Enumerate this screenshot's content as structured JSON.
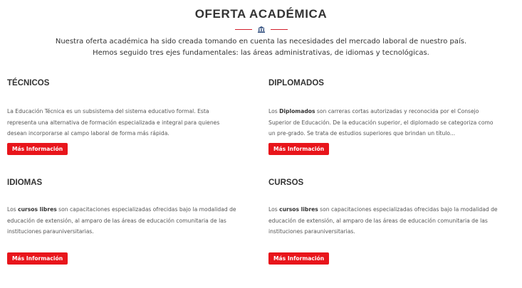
{
  "header": {
    "title": "OFERTA ACADÉMICA",
    "divider_icon": "bank-building-icon",
    "accent_color": "#d21f2b",
    "intro_line_1": "Nuestra oferta académica ha sido creada tomando en cuenta las necesidades del mercado laboral de nuestro país.",
    "intro_line_2": "Hemos seguido tres ejes fundamentales: las áreas administrativas, de idiomas y tecnológicas."
  },
  "cards": {
    "tecnicos": {
      "title": "TÉCNICOS",
      "desc_line_1": "La Educación Técnica es un subsistema del sistema educativo formal. Esta",
      "desc_line_2": "representa una alternativa de formación especializada e integral para quienes",
      "desc_line_3": "desean incorporarse al campo laboral de forma más rápida.",
      "button_label": "Más Información"
    },
    "diplomados": {
      "title": "DIPLOMADOS",
      "desc_pre": "Los ",
      "desc_bold": "Diplomados",
      "desc_line_1_rest": " son carreras cortas autorizadas y reconocida por el Consejo",
      "desc_line_2": "Superior de Educación. De la educación superior, el diplomado se categoriza como",
      "desc_line_3": "un pre-grado. Se trata de estudios superiores que brindan un título...",
      "button_label": "Más Información"
    },
    "idiomas": {
      "title": "IDIOMAS",
      "desc_pre": "Los ",
      "desc_bold": "cursos libres",
      "desc_line_1_rest": " son capacitaciones especializadas ofrecidas bajo la modalidad de",
      "desc_line_2": "educación de extensión, al amparo de las áreas de educación comunitaria de las",
      "desc_line_3": "instituciones parauniversitarias.",
      "button_label": "Más Información"
    },
    "cursos": {
      "title": "CURSOS",
      "desc_pre": "Los ",
      "desc_bold": "cursos libres",
      "desc_line_1_rest": " son capacitaciones especializadas ofrecidas bajo la modalidad de",
      "desc_line_2": "educación de extensión, al amparo de las áreas de educación comunitaria de las",
      "desc_line_3": "instituciones parauniversitarias.",
      "button_label": "Más Información"
    }
  },
  "colors": {
    "button_bg": "#e8151b",
    "button_text": "#ffffff"
  }
}
